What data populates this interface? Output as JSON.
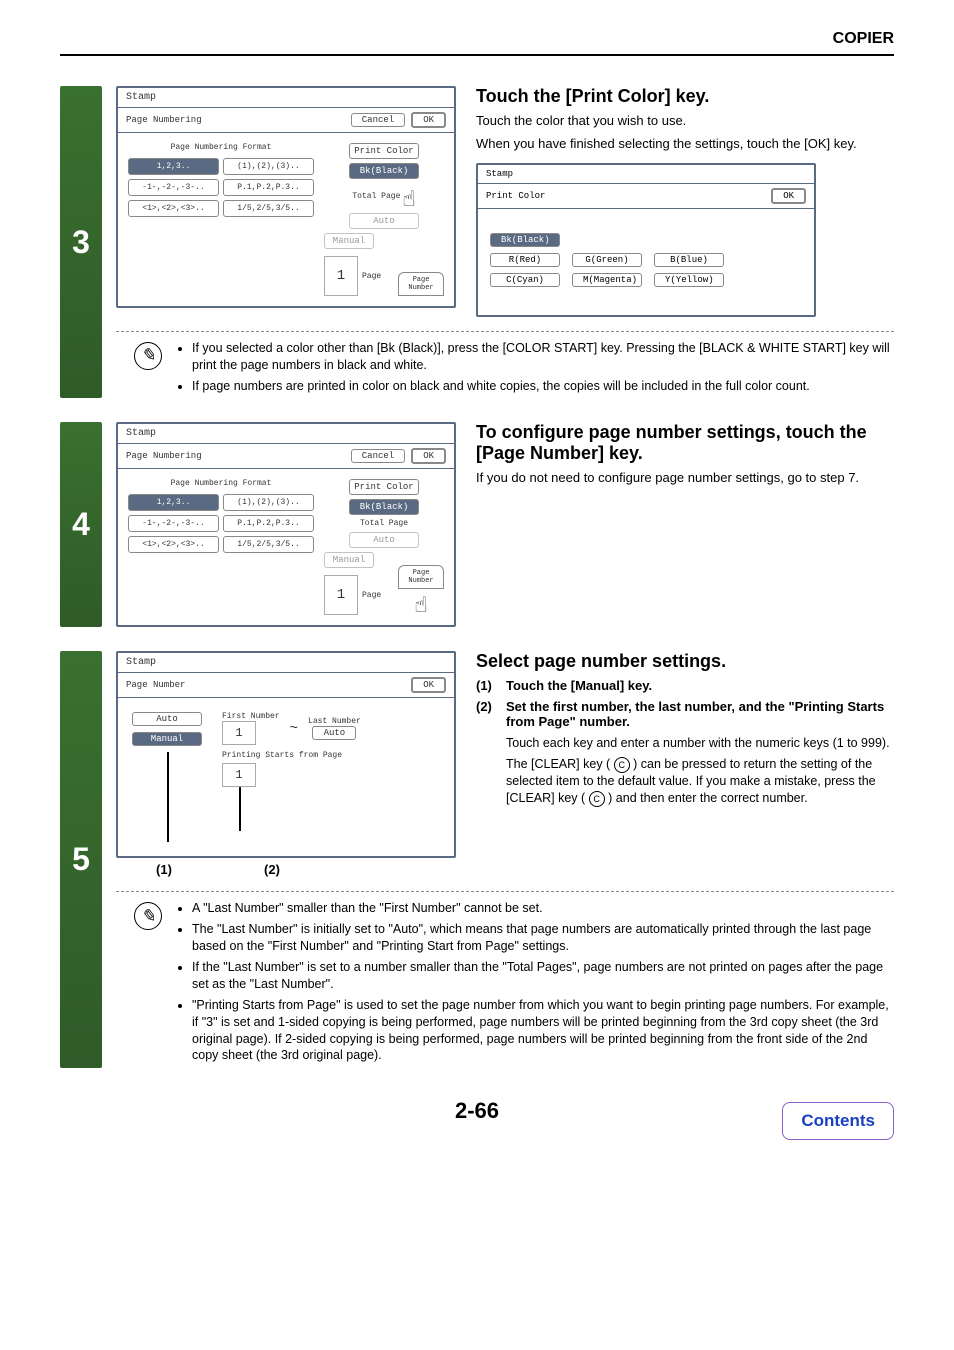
{
  "header": "COPIER",
  "page_number": "2-66",
  "contents_label": "Contents",
  "step3": {
    "num": "3",
    "heading": "Touch the [Print Color] key.",
    "p1": "Touch the color that you wish to use.",
    "p2": "When you have finished selecting the settings, touch the [OK] key.",
    "note1": "If you selected a color other than [Bk (Black)], press the [COLOR START] key. Pressing the [BLACK & WHITE START] key will print the page numbers in black and white.",
    "note2": "If page numbers are printed in color on black and white copies, the copies will be included in the full color count.",
    "screen": {
      "title": "Stamp",
      "sub": "Page Numbering",
      "cancel": "Cancel",
      "ok": "OK",
      "fmt_head": "Page Numbering Format",
      "f1": "1,2,3..",
      "f2": "(1),(2),(3)..",
      "f3": "-1-,-2-,-3-..",
      "f4": "P.1,P.2,P.3..",
      "f5": "<1>,<2>,<3>..",
      "f6": "1/5,2/5,3/5..",
      "r_print_color": "Print Color",
      "r_bk": "Bk(Black)",
      "r_total": "Total Page",
      "r_auto": "Auto",
      "r_manual": "Manual",
      "r_page_num_tab": "Page Number",
      "r_num": "1",
      "r_page": "Page"
    },
    "color_screen": {
      "title": "Stamp",
      "sub": "Print Color",
      "ok": "OK",
      "bk": "Bk(Black)",
      "r": "R(Red)",
      "g": "G(Green)",
      "b": "B(Blue)",
      "c": "C(Cyan)",
      "m": "M(Magenta)",
      "y": "Y(Yellow)"
    }
  },
  "step4": {
    "num": "4",
    "heading": "To configure page number settings, touch the [Page Number] key.",
    "p1": "If you do not need to configure page number settings, go to step 7.",
    "screen": {
      "title": "Stamp",
      "sub": "Page Numbering",
      "cancel": "Cancel",
      "ok": "OK",
      "fmt_head": "Page Numbering Format",
      "f1": "1,2,3..",
      "f2": "(1),(2),(3)..",
      "f3": "-1-,-2-,-3-..",
      "f4": "P.1,P.2,P.3..",
      "f5": "<1>,<2>,<3>..",
      "f6": "1/5,2/5,3/5..",
      "r_print_color": "Print Color",
      "r_bk": "Bk(Black)",
      "r_total": "Total Page",
      "r_auto": "Auto",
      "r_manual": "Manual",
      "r_page_num_tab": "Page Number",
      "r_num": "1",
      "r_page": "Page"
    }
  },
  "step5": {
    "num": "5",
    "heading": "Select page number settings.",
    "s1_idx": "(1)",
    "s1_txt": "Touch the [Manual] key.",
    "s2_idx": "(2)",
    "s2_txt": "Set the first number, the last number, and the \"Printing Starts from Page\" number.",
    "s2_sub1": "Touch each key and enter a number with the numeric keys (1 to 999).",
    "s2_sub2_a": "The [CLEAR] key (",
    "s2_sub2_b": ") can be pressed to return the setting of the selected item to the default value. If you make a mistake, press the [CLEAR] key (",
    "s2_sub2_c": ") and then enter the correct number.",
    "clear_c": "C",
    "callout1": "(1)",
    "callout2": "(2)",
    "note1": "A \"Last Number\" smaller than the \"First Number\" cannot be set.",
    "note2": "The \"Last Number\" is initially set to \"Auto\", which means that page numbers are automatically printed through the last page based on the \"First Number\" and \"Printing Start from Page\" settings.",
    "note3": "If the \"Last Number\" is set to a number smaller than the \"Total Pages\", page numbers are not printed on pages after the page set as the \"Last Number\".",
    "note4": "\"Printing Starts from Page\" is used to set the page number from which you want to begin printing page numbers. For example, if \"3\" is set and 1-sided copying is being performed, page numbers will be printed beginning from the 3rd copy sheet (the 3rd original page). If 2-sided copying is being performed, page numbers will be printed beginning from the front side of the 2nd copy sheet (the 3rd original page).",
    "screen": {
      "title": "Stamp",
      "sub": "Page Number",
      "ok": "OK",
      "auto": "Auto",
      "manual": "Manual",
      "first": "First Number",
      "last": "Last Number",
      "tilde": "~",
      "autoval": "Auto",
      "one": "1",
      "starts": "Printing Starts from Page",
      "one2": "1"
    }
  }
}
